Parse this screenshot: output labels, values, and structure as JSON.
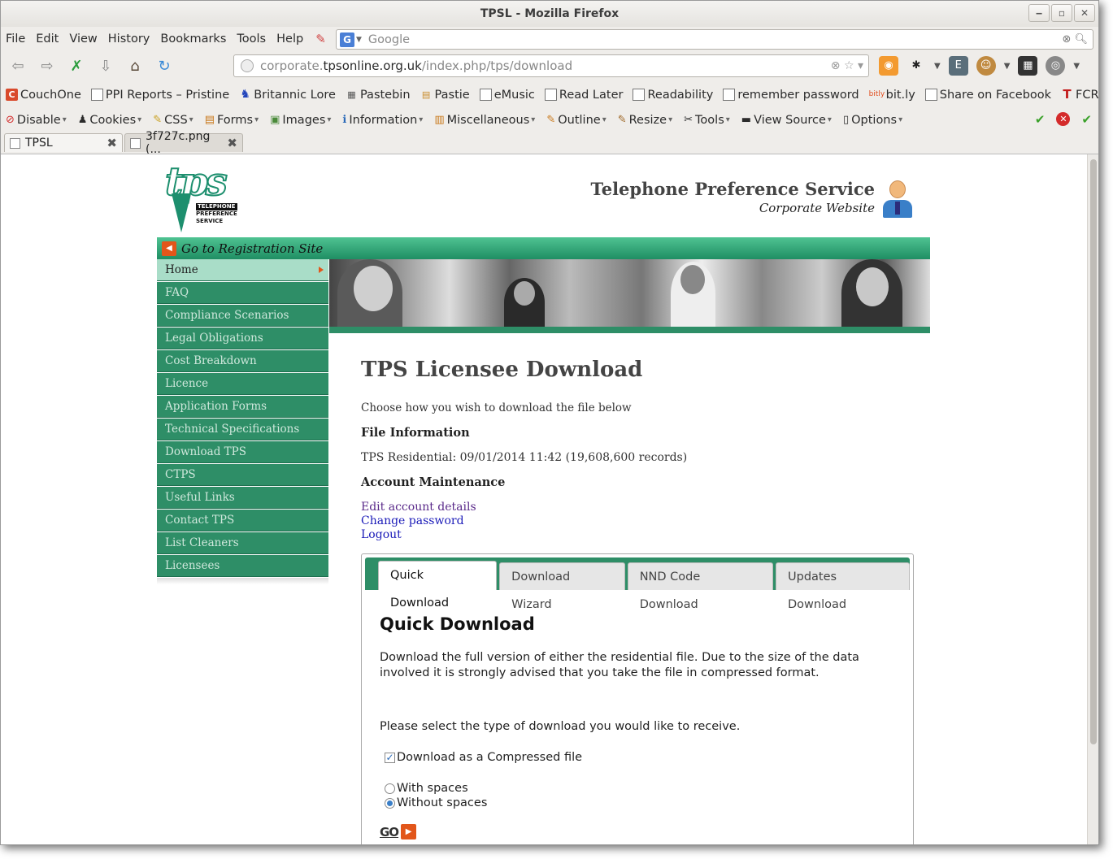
{
  "window": {
    "title": "TPSL - Mozilla Firefox"
  },
  "menubar": {
    "items": [
      "File",
      "Edit",
      "View",
      "History",
      "Bookmarks",
      "Tools",
      "Help"
    ],
    "search_engine": "G",
    "search_placeholder": "Google"
  },
  "navbar": {
    "url_prefix": "corporate.",
    "url_domain": "tpsonline.org.uk",
    "url_path": "/index.php/tps/download"
  },
  "bookmarks": {
    "items": [
      {
        "label": "CouchOne",
        "icon": "couch-icon"
      },
      {
        "label": "PPI Reports – Pristine",
        "icon": "page-icon"
      },
      {
        "label": "Britannic Lore",
        "icon": "bl-icon"
      },
      {
        "label": "Pastebin",
        "icon": "pastebin-icon"
      },
      {
        "label": "Pastie",
        "icon": "pastie-icon"
      },
      {
        "label": "eMusic",
        "icon": "page-icon"
      },
      {
        "label": "Read Later",
        "icon": "page-icon"
      },
      {
        "label": "Readability",
        "icon": "page-icon"
      },
      {
        "label": "remember password",
        "icon": "page-icon"
      },
      {
        "label": "bit.ly",
        "icon": "bitly-icon"
      },
      {
        "label": "Share on Facebook",
        "icon": "page-icon"
      },
      {
        "label": "FCRS",
        "icon": "fcrs-icon"
      }
    ],
    "more": "»"
  },
  "devbar": {
    "items": [
      "Disable",
      "Cookies",
      "CSS",
      "Forms",
      "Images",
      "Information",
      "Miscellaneous",
      "Outline",
      "Resize",
      "Tools",
      "View Source",
      "Options"
    ]
  },
  "tabs": [
    {
      "label": "TPSL"
    },
    {
      "label": "3f727c.png (..."
    }
  ],
  "site": {
    "logo_text": "tps",
    "logo_sub": [
      "TELEPHONE",
      "PREFERENCE",
      "SERVICE"
    ],
    "header_title": "Telephone Preference Service",
    "header_sub": "Corporate Website",
    "reg_link": "Go to Registration Site",
    "sidebar": [
      "Home",
      "FAQ",
      "Compliance Scenarios",
      "Legal Obligations",
      "Cost Breakdown",
      "Licence",
      "Application Forms",
      "Technical Specifications",
      "Download TPS",
      "CTPS",
      "Useful Links",
      "Contact TPS",
      "List Cleaners",
      "Licensees"
    ],
    "sidebar_active": "Home",
    "page_title": "TPS Licensee Download",
    "intro": "Choose how you wish to download the file below",
    "file_info_heading": "File Information",
    "file_info": "TPS Residential: 09/01/2014 11:42 (19,608,600 records)",
    "account_heading": "Account Maintenance",
    "links": [
      "Edit account details",
      "Change password",
      "Logout"
    ],
    "download_tabs": [
      "Quick Download",
      "Download Wizard",
      "NND Code Download",
      "Updates Download"
    ],
    "active_tab": "Quick Download",
    "quick": {
      "title": "Quick Download",
      "description": "Download the full version of either the residential file. Due to the size of the data involved it is strongly advised that you take the file in compressed format.",
      "select_prompt": "Please select the type of download you would like to receive.",
      "compressed_label": "Download as a Compressed file",
      "compressed_checked": true,
      "with_spaces_label": "With spaces",
      "without_spaces_label": "Without spaces",
      "spacing_selected": "Without spaces",
      "go_label": "GO"
    }
  },
  "colors": {
    "green": "#2e8e67",
    "green_light": "#a9ddc8",
    "orange": "#e2561a"
  }
}
